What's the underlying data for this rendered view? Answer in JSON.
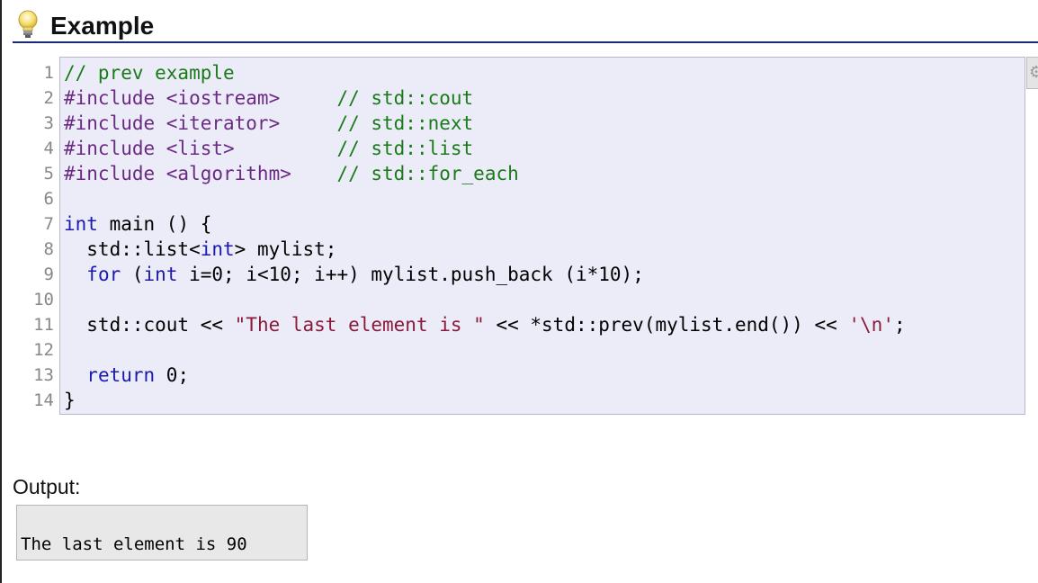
{
  "header": {
    "title": "Example",
    "icon": "lightbulb-icon"
  },
  "code": {
    "lines": [
      {
        "num": "1",
        "tokens": [
          {
            "t": "cm",
            "v": "// prev example"
          }
        ]
      },
      {
        "num": "2",
        "tokens": [
          {
            "t": "pp",
            "v": "#include <iostream>"
          },
          {
            "t": "pl",
            "v": "     "
          },
          {
            "t": "cm",
            "v": "// std::cout"
          }
        ]
      },
      {
        "num": "3",
        "tokens": [
          {
            "t": "pp",
            "v": "#include <iterator>"
          },
          {
            "t": "pl",
            "v": "     "
          },
          {
            "t": "cm",
            "v": "// std::next"
          }
        ]
      },
      {
        "num": "4",
        "tokens": [
          {
            "t": "pp",
            "v": "#include <list>"
          },
          {
            "t": "pl",
            "v": "         "
          },
          {
            "t": "cm",
            "v": "// std::list"
          }
        ]
      },
      {
        "num": "5",
        "tokens": [
          {
            "t": "pp",
            "v": "#include <algorithm>"
          },
          {
            "t": "pl",
            "v": "    "
          },
          {
            "t": "cm",
            "v": "// std::for_each"
          }
        ]
      },
      {
        "num": "6",
        "tokens": []
      },
      {
        "num": "7",
        "tokens": [
          {
            "t": "kw",
            "v": "int"
          },
          {
            "t": "pl",
            "v": " main () {"
          }
        ]
      },
      {
        "num": "8",
        "tokens": [
          {
            "t": "pl",
            "v": "  std::list<"
          },
          {
            "t": "kw",
            "v": "int"
          },
          {
            "t": "pl",
            "v": "> mylist;"
          }
        ]
      },
      {
        "num": "9",
        "tokens": [
          {
            "t": "pl",
            "v": "  "
          },
          {
            "t": "kw",
            "v": "for"
          },
          {
            "t": "pl",
            "v": " ("
          },
          {
            "t": "kw",
            "v": "int"
          },
          {
            "t": "pl",
            "v": " i=0; i<10; i++) mylist.push_back (i*10);"
          }
        ]
      },
      {
        "num": "10",
        "tokens": []
      },
      {
        "num": "11",
        "tokens": [
          {
            "t": "pl",
            "v": "  std::cout << "
          },
          {
            "t": "st",
            "v": "\"The last element is \""
          },
          {
            "t": "pl",
            "v": " << *std::prev(mylist.end()) << "
          },
          {
            "t": "st",
            "v": "'\\n'"
          },
          {
            "t": "pl",
            "v": ";"
          }
        ]
      },
      {
        "num": "12",
        "tokens": []
      },
      {
        "num": "13",
        "tokens": [
          {
            "t": "pl",
            "v": "  "
          },
          {
            "t": "kw",
            "v": "return"
          },
          {
            "t": "pl",
            "v": " 0;"
          }
        ]
      },
      {
        "num": "14",
        "tokens": [
          {
            "t": "pl",
            "v": "}"
          }
        ]
      }
    ],
    "colors": {
      "comment": "#1a7a1a",
      "preprocessor": "#6b2a83",
      "keyword": "#1a1ab0",
      "string": "#8a1a3a",
      "background": "#ececf8"
    },
    "options_icon": "gear-icon"
  },
  "output": {
    "label": "Output:",
    "text": "The last element is 90"
  }
}
